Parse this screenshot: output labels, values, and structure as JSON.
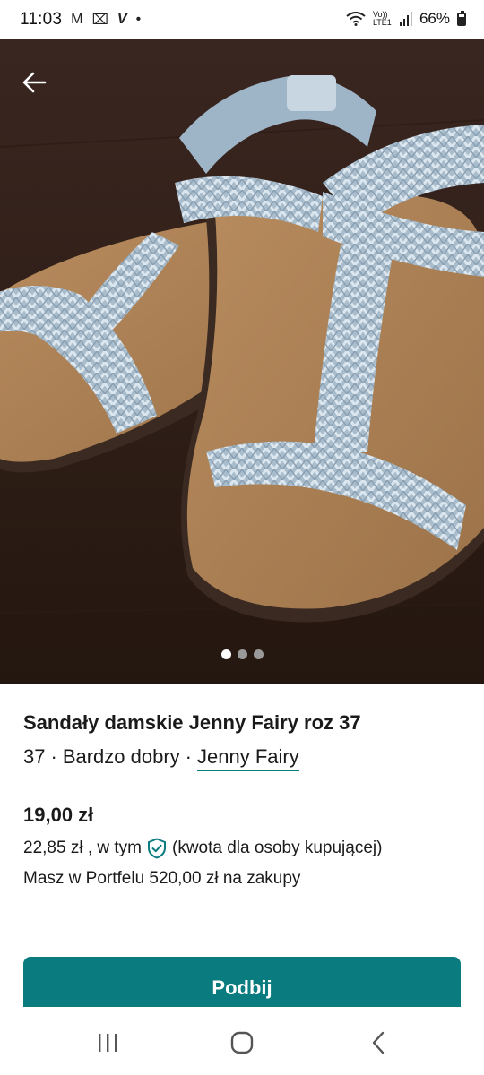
{
  "status_bar": {
    "time": "11:03",
    "notif_icons": [
      "M",
      "⌧",
      "V",
      "•"
    ],
    "network_label": "Vo)) LTE1",
    "battery": "66%"
  },
  "gallery": {
    "image_count": 3,
    "active_index": 0,
    "back_icon": "arrow-left-icon"
  },
  "listing": {
    "title": "Sandały damskie Jenny Fairy roz 37",
    "size": "37",
    "separator": "·",
    "condition": "Bardzo dobry",
    "brand": "Jenny Fairy",
    "price": "19,00 zł",
    "price_total": "22,85 zł , w tym",
    "buyer_protection_note": "(kwota dla osoby kupującej)",
    "wallet_note": "Masz w Portfelu 520,00 zł na zakupy"
  },
  "actions": {
    "bump_label": "Podbij"
  },
  "colors": {
    "accent": "#0a7b7e"
  }
}
